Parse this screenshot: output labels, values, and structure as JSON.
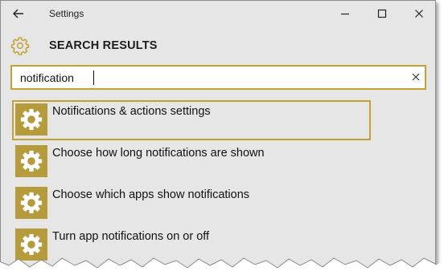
{
  "window": {
    "title": "Settings"
  },
  "header": {
    "title": "SEARCH RESULTS",
    "icon": "gear-icon"
  },
  "search": {
    "value": "notification",
    "placeholder": ""
  },
  "results": [
    {
      "label": "Notifications & actions settings",
      "icon": "gear-icon",
      "selected": true
    },
    {
      "label": "Choose how long notifications are shown",
      "icon": "gear-icon",
      "selected": false
    },
    {
      "label": "Choose which apps show notifications",
      "icon": "gear-icon",
      "selected": false
    },
    {
      "label": "Turn app notifications on or off",
      "icon": "gear-icon",
      "selected": false
    }
  ],
  "colors": {
    "accent": "#c3a233",
    "tile": "#b69b3c",
    "background": "#e6e6e6"
  }
}
